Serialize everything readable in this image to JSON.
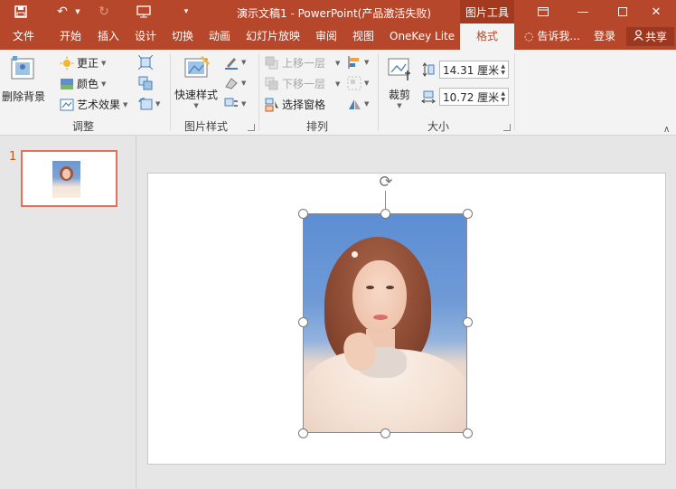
{
  "titlebar": {
    "title": "演示文稿1 - PowerPoint(产品激活失败)",
    "context_label": "图片工具",
    "quick_access": [
      "save-icon",
      "undo-icon",
      "redo-icon",
      "present-icon",
      "customize-icon"
    ]
  },
  "tabs": [
    "文件",
    "开始",
    "插入",
    "设计",
    "切换",
    "动画",
    "幻灯片放映",
    "审阅",
    "视图",
    "OneKey Lite",
    "格式"
  ],
  "active_tab": "格式",
  "header_right": {
    "tell_me": "告诉我...",
    "login": "登录",
    "share": "共享"
  },
  "ribbon": {
    "adjust": {
      "remove_bg": "删除背景",
      "corrections": "更正",
      "color": "颜色",
      "artistic": "艺术效果",
      "label": "调整"
    },
    "picture_styles": {
      "quick_styles": "快速样式",
      "label": "图片样式"
    },
    "arrange": {
      "bring_forward": "上移一层",
      "send_backward": "下移一层",
      "selection_pane": "选择窗格",
      "label": "排列"
    },
    "size": {
      "crop": "裁剪",
      "height": "14.31 厘米",
      "width": "10.72 厘米",
      "label": "大小"
    }
  },
  "thumbnails": {
    "slide_number": "1"
  },
  "colors": {
    "accent": "#b7472a",
    "ribbon_bg": "#f3f3f3",
    "thumb_border": "#e0715b"
  }
}
